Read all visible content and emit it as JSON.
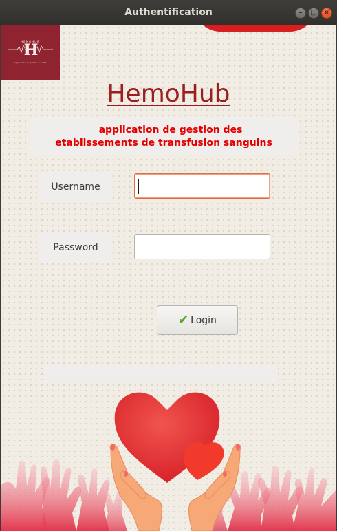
{
  "window": {
    "title": "Authentification",
    "minimize_glyph": "–",
    "maximize_glyph": "□",
    "close_glyph": "×"
  },
  "logo": {
    "monogram": "H",
    "brand": "HEMOHUB",
    "tagline": "Application de gestion des CTS"
  },
  "header": {
    "title": "HemoHub",
    "subtitle_line1": "application de gestion des",
    "subtitle_line2": "etablissements de transfusion sanguins"
  },
  "form": {
    "username_label": "Username",
    "username_value": "",
    "password_label": "Password",
    "password_value": "",
    "login_label": "Login",
    "login_icon": "check-icon"
  },
  "colors": {
    "brand_red": "#9c1f1f",
    "subtitle_red": "#e50000",
    "logo_bg": "#8f2430",
    "heart_red": "#e3262c",
    "check_green": "#5aa531"
  }
}
